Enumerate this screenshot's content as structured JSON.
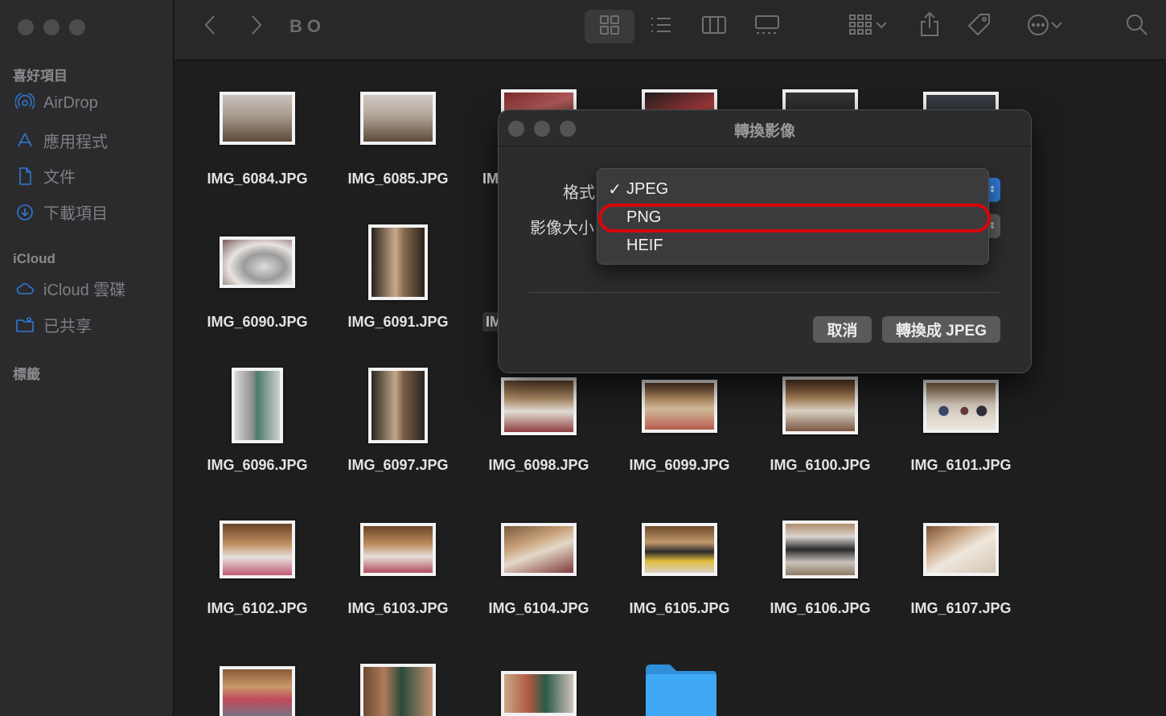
{
  "window": {
    "title": "BO"
  },
  "sidebar": {
    "favorites_header": "喜好項目",
    "favorites": [
      {
        "label": "AirDrop",
        "icon": "airdrop-icon"
      },
      {
        "label": "應用程式",
        "icon": "applications-icon"
      },
      {
        "label": "文件",
        "icon": "document-icon"
      },
      {
        "label": "下載項目",
        "icon": "download-icon"
      }
    ],
    "icloud_header": "iCloud",
    "icloud": [
      {
        "label": "iCloud 雲碟",
        "icon": "cloud-icon"
      },
      {
        "label": "已共享",
        "icon": "shared-folder-icon"
      }
    ],
    "tags_header": "標籤"
  },
  "files": [
    "IMG_6084.JPG",
    "IMG_6085.JPG",
    "IM",
    "IMG_6090.JPG",
    "IMG_6091.JPG",
    "IM",
    "IMG_6096.JPG",
    "IMG_6097.JPG",
    "IMG_6098.JPG",
    "IMG_6099.JPG",
    "IMG_6100.JPG",
    "IMG_6101.JPG",
    "IMG_6102.JPG",
    "IMG_6103.JPG",
    "IMG_6104.JPG",
    "IMG_6105.JPG",
    "IMG_6106.JPG",
    "IMG_6107.JPG"
  ],
  "dialog": {
    "title": "轉換影像",
    "format_label": "格式",
    "size_label": "影像大小",
    "cancel_label": "取消",
    "convert_label": "轉換成 JPEG"
  },
  "format_menu": {
    "options": [
      "JPEG",
      "PNG",
      "HEIF"
    ],
    "selected": "JPEG",
    "check_mark": "✓"
  },
  "colors": {
    "accent": "#2f78d3",
    "highlight_ring": "#d8060b",
    "folder": "#3fa9f5"
  }
}
